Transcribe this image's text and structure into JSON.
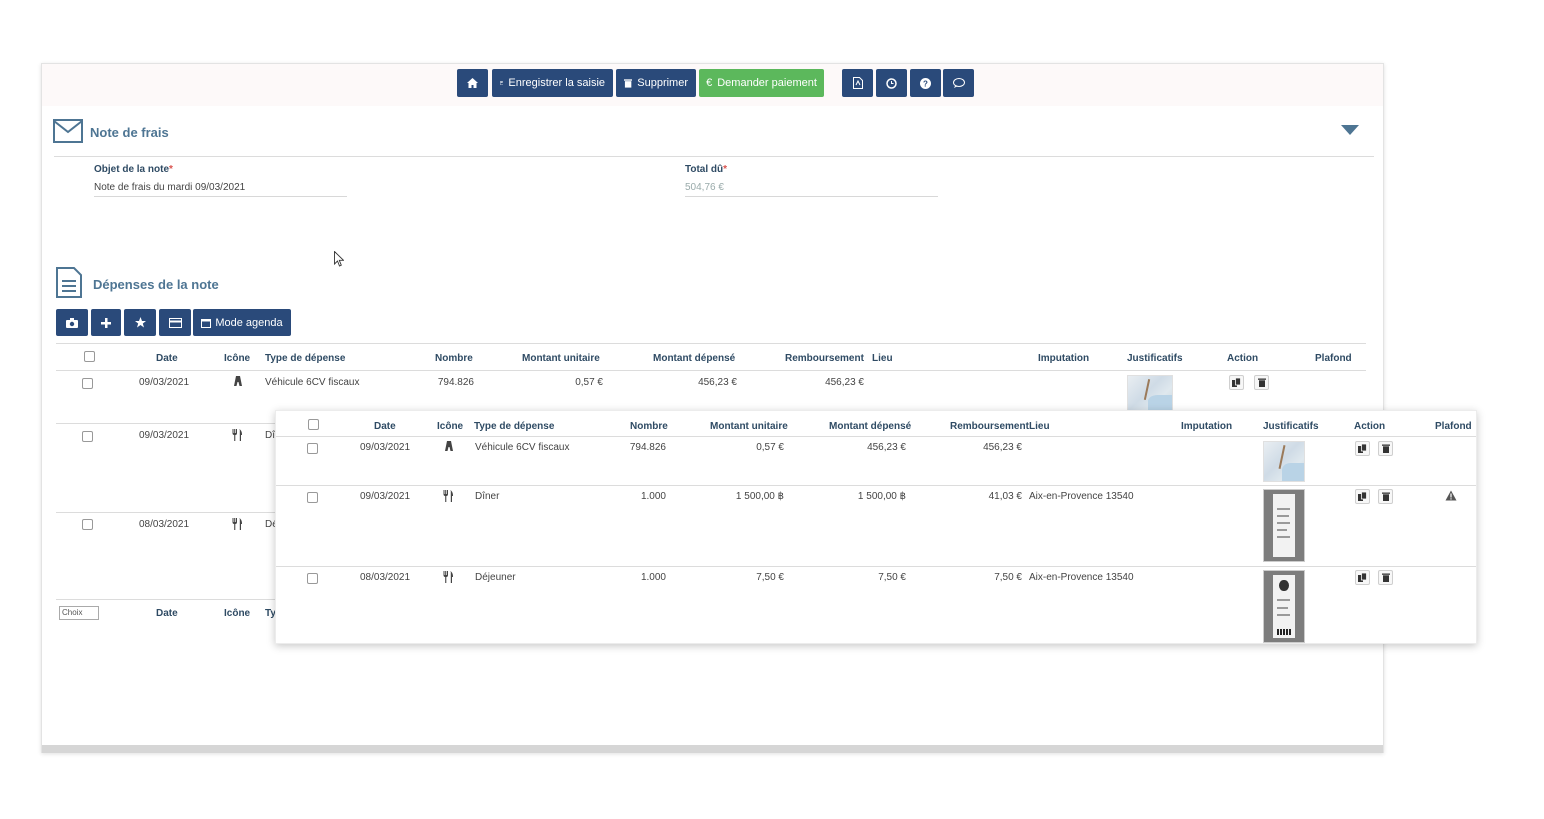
{
  "toolbar": {
    "save_label": "Enregistrer la saisie",
    "delete_label": "Supprimer",
    "payment_label": "Demander paiement",
    "payment_color": "#5cb85c",
    "accent_color": "#2a4a7a"
  },
  "note_section": {
    "title": "Note de frais",
    "object_label": "Objet de la note",
    "object_value": "Note de frais du mardi 09/03/2021",
    "total_label": "Total dû",
    "total_value": "504,76 €",
    "required_mark": "*"
  },
  "expenses_section": {
    "title": "Dépenses de la note",
    "agenda_label": "Mode agenda"
  },
  "table": {
    "headers": {
      "date": "Date",
      "icon": "Icône",
      "type": "Type de dépense",
      "nombre": "Nombre",
      "unitaire": "Montant unitaire",
      "depense": "Montant dépensé",
      "remb": "Remboursement",
      "lieu": "Lieu",
      "imputation": "Imputation",
      "justif": "Justificatifs",
      "action": "Action",
      "plafond": "Plafond"
    },
    "rows": [
      {
        "date": "09/03/2021",
        "icon": "car-icon",
        "type": "Véhicule 6CV fiscaux",
        "nombre": "794.826",
        "unitaire": "0,57 €",
        "depense": "456,23 €",
        "remb": "456,23 €",
        "lieu": ""
      },
      {
        "date": "09/03/2021",
        "icon": "cutlery-icon",
        "type": "Dîner",
        "nombre": "1.000",
        "unitaire": "1 500,00 ฿",
        "depense": "1 500,00 ฿",
        "remb": "41,03 €",
        "lieu": "Aix-en-Provence 13540"
      },
      {
        "date": "08/03/2021",
        "icon": "cutlery-icon",
        "type": "Déjeuner",
        "nombre": "1.000",
        "unitaire": "7,50 €",
        "depense": "7,50 €",
        "remb": "7,50 €",
        "lieu": "Aix-en-Provence 13540"
      }
    ],
    "bg_type_partial": [
      "Dî",
      "Dé"
    ],
    "bg_footer_type_partial": "Ty",
    "choix_label": "Choix"
  }
}
